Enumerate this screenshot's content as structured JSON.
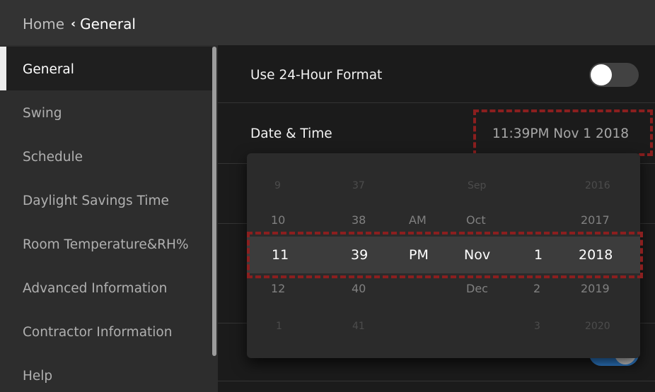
{
  "header": {
    "home_label": "Home",
    "back_chevron": "‹",
    "current_label": "General"
  },
  "sidebar": {
    "items": [
      {
        "label": "General",
        "active": true
      },
      {
        "label": "Swing"
      },
      {
        "label": "Schedule"
      },
      {
        "label": "Daylight Savings Time"
      },
      {
        "label": "Room Temperature&RH%"
      },
      {
        "label": "Advanced Information"
      },
      {
        "label": "Contractor Information"
      },
      {
        "label": "Help"
      }
    ]
  },
  "settings": {
    "use_24_hour": {
      "label": "Use 24-Hour Format",
      "enabled": false
    },
    "date_time": {
      "label": "Date & Time",
      "value": "11:39PM Nov 1 2018"
    },
    "hidden_toggle": {
      "enabled": true
    }
  },
  "picker": {
    "hour": {
      "values": [
        "9",
        "10",
        "11",
        "12",
        "1"
      ],
      "selected": "11"
    },
    "minute": {
      "values": [
        "37",
        "38",
        "39",
        "40",
        "41"
      ],
      "selected": "39"
    },
    "ampm": {
      "values": [
        "",
        "AM",
        "PM",
        "",
        ""
      ],
      "selected": "PM"
    },
    "month": {
      "values": [
        "Sep",
        "Oct",
        "Nov",
        "Dec",
        ""
      ],
      "selected": "Nov"
    },
    "day": {
      "values": [
        "",
        "",
        "1",
        "2",
        "3"
      ],
      "selected": "1"
    },
    "year": {
      "values": [
        "2016",
        "2017",
        "2018",
        "2019",
        "2020"
      ],
      "selected": "2018"
    }
  },
  "colors": {
    "highlight_border": "#8b1f1f",
    "toggle_on": "#2f7fd0",
    "toggle_off": "#424242",
    "topbar_bg": "#333333",
    "sidebar_bg": "#2d2d2d"
  }
}
